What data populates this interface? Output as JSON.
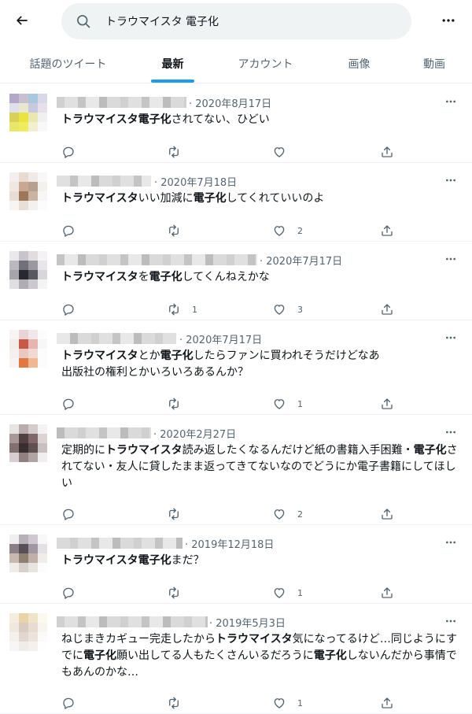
{
  "search": {
    "query": "トラウマイスタ 電子化"
  },
  "tabs": [
    {
      "label": "話題のツイート",
      "active": false
    },
    {
      "label": "最新",
      "active": true
    },
    {
      "label": "アカウント",
      "active": false
    },
    {
      "label": "画像",
      "active": false
    },
    {
      "label": "動画",
      "active": false
    }
  ],
  "colors": {
    "accent": "#1d9bf0",
    "text": "#0f1419",
    "muted": "#536471",
    "search_bg": "#eff3f4",
    "divider": "#eff3f4"
  },
  "tweets": [
    {
      "date": "· 2020年8月17日",
      "segments": [
        {
          "t": "トラウマイスタ電子化",
          "b": true
        },
        {
          "t": "されてない、ひどい",
          "b": false
        }
      ],
      "counts": {
        "reply": "",
        "retweet": "",
        "like": ""
      }
    },
    {
      "date": "· 2020年7月18日",
      "segments": [
        {
          "t": "トラウマイスタ",
          "b": true
        },
        {
          "t": "いい加減に",
          "b": false
        },
        {
          "t": "電子化",
          "b": true
        },
        {
          "t": "してくれていいのよ",
          "b": false
        }
      ],
      "counts": {
        "reply": "",
        "retweet": "",
        "like": "2"
      }
    },
    {
      "date": "· 2020年7月17日",
      "segments": [
        {
          "t": "トラウマイスタ",
          "b": true
        },
        {
          "t": "を",
          "b": false
        },
        {
          "t": "電子化",
          "b": true
        },
        {
          "t": "してくんねえかな",
          "b": false
        }
      ],
      "counts": {
        "reply": "",
        "retweet": "1",
        "like": "3"
      }
    },
    {
      "date": "· 2020年7月17日",
      "segments": [
        {
          "t": "トラウマイスタ",
          "b": true
        },
        {
          "t": "とか",
          "b": false
        },
        {
          "t": "電子化",
          "b": true
        },
        {
          "t": "したらファンに買われそうだけどなあ\n出版社の権利とかいろいろあるんか？",
          "b": false
        }
      ],
      "counts": {
        "reply": "",
        "retweet": "",
        "like": "1"
      }
    },
    {
      "date": "· 2020年2月27日",
      "segments": [
        {
          "t": "定期的に",
          "b": false
        },
        {
          "t": "トラウマイスタ",
          "b": true
        },
        {
          "t": "読み返したくなるんだけど紙の書籍入手困難・",
          "b": false
        },
        {
          "t": "電子化",
          "b": true
        },
        {
          "t": "されてない・友人に貸したまま返ってきてないなのでどうにか電子書籍にしてほしい",
          "b": false
        }
      ],
      "counts": {
        "reply": "",
        "retweet": "",
        "like": "2"
      }
    },
    {
      "date": "· 2019年12月18日",
      "segments": [
        {
          "t": "トラウマイスタ電子化",
          "b": true
        },
        {
          "t": "まだ？",
          "b": false
        }
      ],
      "counts": {
        "reply": "",
        "retweet": "",
        "like": "1"
      }
    },
    {
      "date": "· 2019年5月3日",
      "segments": [
        {
          "t": "ねじまきカギュー完走したから",
          "b": false
        },
        {
          "t": "トラウマイスタ",
          "b": true
        },
        {
          "t": "気になってるけど…同じようにすでに",
          "b": false
        },
        {
          "t": "電子化",
          "b": true
        },
        {
          "t": "願い出してる人もたくさんいるだろうに",
          "b": false
        },
        {
          "t": "電子化",
          "b": true
        },
        {
          "t": "しないんだから事情でもあんのかな…",
          "b": false
        }
      ],
      "counts": {
        "reply": "",
        "retweet": "",
        "like": "1"
      }
    }
  ]
}
